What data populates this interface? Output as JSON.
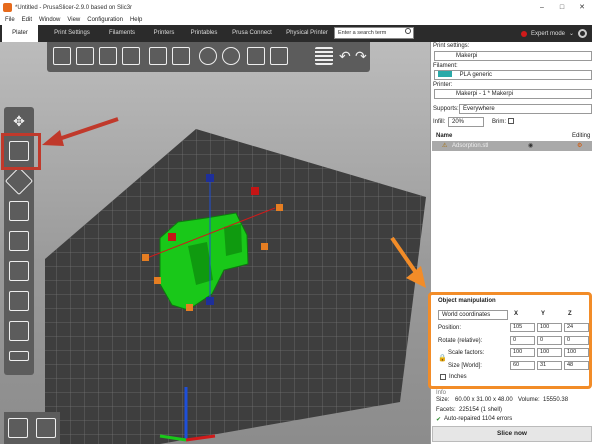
{
  "window": {
    "title": "*Untitled - PrusaSlicer-2.9.0 based on Slic3r",
    "controls": [
      "–",
      "□",
      "✕"
    ]
  },
  "menu": [
    "File",
    "Edit",
    "Window",
    "View",
    "Configuration",
    "Help"
  ],
  "tabs": [
    "Plater",
    "Print Settings",
    "Filaments",
    "Printers",
    "Printables",
    "Prusa Connect",
    "Physical Printer"
  ],
  "search": {
    "placeholder": "Enter a search term"
  },
  "mode": {
    "label": "Expert mode",
    "color": "#d01a1a"
  },
  "right": {
    "print_settings_label": "Print settings:",
    "print_profile": "Makerpi",
    "filament_label": "Filament:",
    "filament_profile": "PLA generic",
    "filament_color": "#2aa9a8",
    "printer_label": "Printer:",
    "printer_profile": "Makerpi - 1 * Makerpi",
    "supports_label": "Supports:",
    "supports_value": "Everywhere",
    "infill_label": "Infill:",
    "infill_value": "20%",
    "brim_label": "Brim:",
    "list_header_name": "Name",
    "list_header_editing": "Editing",
    "object_name": "Adsorption.stl"
  },
  "object_manipulation": {
    "title": "Object manipulation",
    "coords": "World coordinates",
    "axes": [
      "X",
      "Y",
      "Z"
    ],
    "position_label": "Position:",
    "position": [
      "105",
      "100",
      "24"
    ],
    "rotate_label": "Rotate (relative):",
    "rotate": [
      "0",
      "0",
      "0"
    ],
    "scale_label": "Scale factors:",
    "scale": [
      "100",
      "100",
      "100"
    ],
    "size_label": "Size [World]:",
    "size": [
      "60",
      "31",
      "48"
    ],
    "inches_label": "Inches"
  },
  "info": {
    "heading": "Info",
    "size_label": "Size:",
    "size_value": "60.00 x 31.00 x 48.00",
    "volume_label": "Volume:",
    "volume_value": "15550.38",
    "facets_label": "Facets:",
    "facets_value": "225154 (1 shell)",
    "repair": "Auto-repaired 1104 errors"
  },
  "slice_button": "Slice now",
  "colors": {
    "highlight_red": "#c0392b",
    "highlight_orange": "#f28c28",
    "model_green": "#19c819"
  }
}
